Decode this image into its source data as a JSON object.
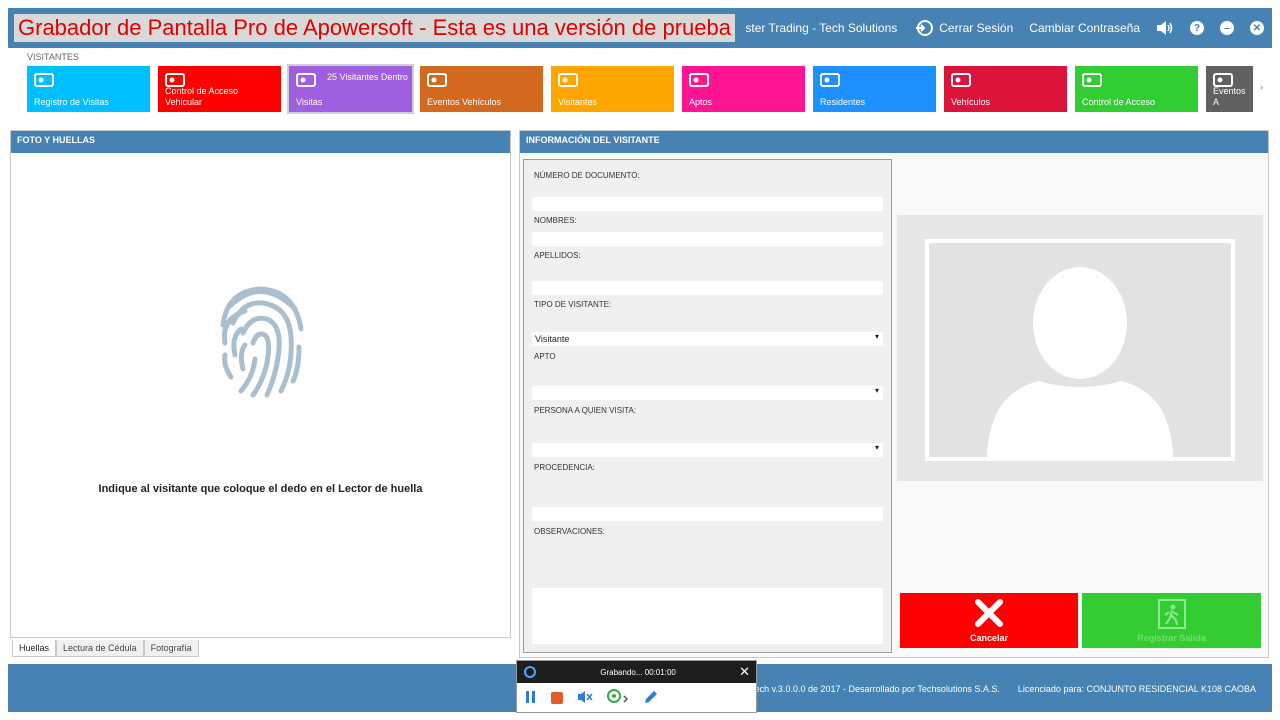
{
  "titlebar": {
    "watermark": "Grabador de Pantalla Pro de Apowersoft - Esta es una versión de prueba",
    "company": "ster Trading - Tech Solutions",
    "logout_label": "Cerrar Sesión",
    "change_password_label": "Cambiar Contraseña",
    "help_glyph": "?",
    "minimize_glyph": "–",
    "close_glyph": "✕"
  },
  "ribbon": {
    "section_label": "VISITANTES",
    "tiles": [
      {
        "label": "Registro de Visitas",
        "color": "#00bfff",
        "icon": "id-card-icon"
      },
      {
        "label": "Control de Acceso Vehicular",
        "color": "#ff0000",
        "icon": "car-icon"
      },
      {
        "label": "Visitas",
        "extra": "25 Visitantes Dentro",
        "color": "#a05ee0",
        "icon": "visitor-badge-icon"
      },
      {
        "label": "Eventos Vehículos",
        "color": "#d2691e",
        "icon": "garage-icon"
      },
      {
        "label": "Visitantes",
        "color": "#ffa500",
        "icon": "people-icon"
      },
      {
        "label": "Aptos",
        "color": "#ff1493",
        "icon": "building-icon"
      },
      {
        "label": "Residentes",
        "color": "#1e90ff",
        "icon": "resident-icon"
      },
      {
        "label": "Vehículos",
        "color": "#dc143c",
        "icon": "car-icon"
      },
      {
        "label": "Control de Acceso",
        "color": "#32cd32",
        "icon": "access-card-icon"
      },
      {
        "label": "Eventos A",
        "color": "#606060",
        "icon": "document-icon"
      }
    ],
    "next_glyph": "›"
  },
  "left_panel": {
    "header": "FOTO Y HUELLAS",
    "instruction": "Indique al visitante que coloque el dedo en el Lector de huella",
    "tabs": [
      "Huellas",
      "Lectura de Cédula",
      "Fotografía"
    ]
  },
  "right_panel": {
    "header": "INFORMACIÓN DEL VISITANTE",
    "fields": {
      "documento_label": "NÚMERO DE DOCUMENTO:",
      "documento_value": "",
      "nombres_label": "NOMBRES:",
      "nombres_value": "",
      "apellidos_label": "APELLIDOS:",
      "apellidos_value": "",
      "tipo_label": "TIPO DE VISITANTE:",
      "tipo_value": "Visitante",
      "apto_label": "APTO",
      "apto_value": "",
      "persona_label": "PERSONA A QUIEN VISITA:",
      "persona_value": "",
      "procedencia_label": "PROCEDENCIA:",
      "procedencia_value": "",
      "observaciones_label": "OBSERVACIONES:",
      "observaciones_value": ""
    },
    "cancel_label": "Cancelar",
    "register_exit_label": "Registrar Salida"
  },
  "footer": {
    "version": "Visitor Tech v.3.0.0.0 de 2017 - Desarrollado por Techsolutions S.A.S.",
    "license": "Licenciado para: CONJUNTO RESIDENCIAL K108 CAOBA"
  },
  "recorder": {
    "status": "Grabando... 00:01:00",
    "close_glyph": "✕"
  }
}
